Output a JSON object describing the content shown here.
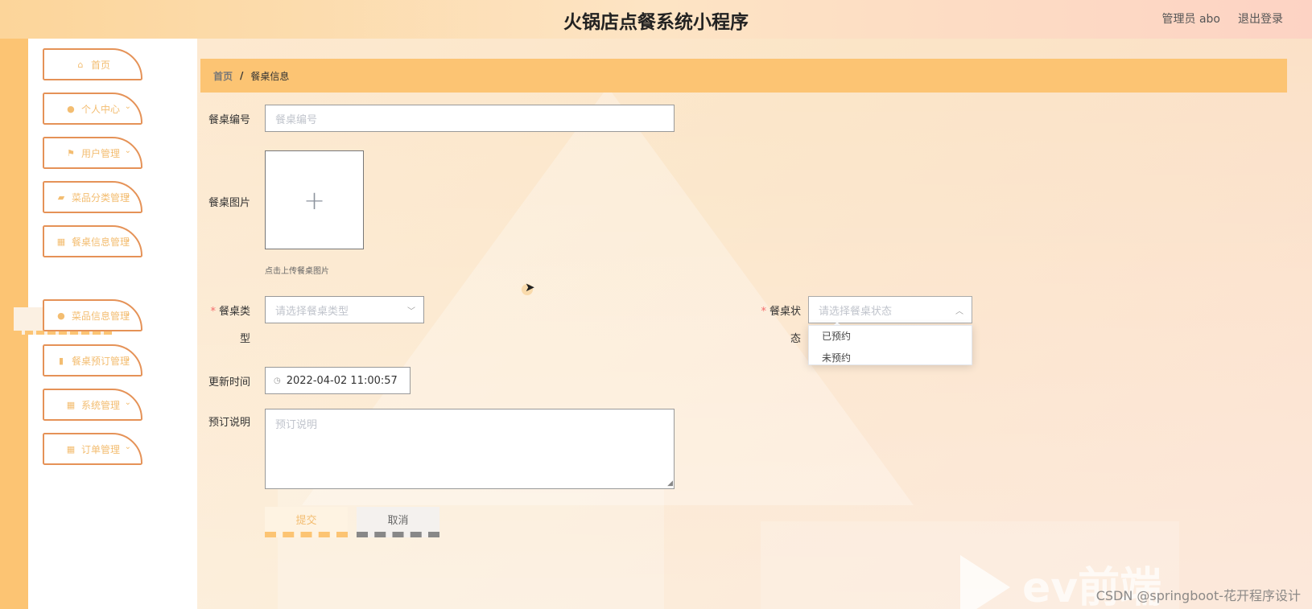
{
  "header": {
    "title": "火锅店点餐系统小程序",
    "user_label": "管理员 abo",
    "logout_label": "退出登录"
  },
  "sidebar": {
    "items": [
      {
        "label": "首页",
        "icon": "home-icon",
        "has_arrow": false
      },
      {
        "label": "个人中心",
        "icon": "user-icon",
        "has_arrow": true
      },
      {
        "label": "用户管理",
        "icon": "flag-icon",
        "has_arrow": true
      },
      {
        "label": "菜品分类管理",
        "icon": "chat-icon",
        "has_arrow": true
      },
      {
        "label": "餐桌信息管理",
        "icon": "grid-icon",
        "has_arrow": true
      },
      {
        "label": "菜品信息管理",
        "icon": "location-icon",
        "has_arrow": true
      },
      {
        "label": "餐桌预订管理",
        "icon": "bar-chart-icon",
        "has_arrow": true
      },
      {
        "label": "系统管理",
        "icon": "grid-icon",
        "has_arrow": true
      },
      {
        "label": "订单管理",
        "icon": "grid-icon",
        "has_arrow": true
      }
    ],
    "active_sub": "餐桌信息"
  },
  "breadcrumb": {
    "home": "首页",
    "separator": "/",
    "current": "餐桌信息"
  },
  "form": {
    "table_no_label": "餐桌编号",
    "table_no_placeholder": "餐桌编号",
    "image_label": "餐桌图片",
    "upload_tip": "点击上传餐桌图片",
    "type_label_1": "餐桌类",
    "type_label_2": "型",
    "type_placeholder": "请选择餐桌类型",
    "status_label_1": "餐桌状",
    "status_label_2": "态",
    "status_placeholder": "请选择餐桌状态",
    "status_options": [
      "已预约",
      "未预约"
    ],
    "update_time_label": "更新时间",
    "update_time_value": "2022-04-02 11:00:57",
    "remark_label": "预订说明",
    "remark_placeholder": "预订说明",
    "submit_label": "提交",
    "cancel_label": "取消",
    "required_mark": "*"
  },
  "watermark": "CSDN @springboot-花开程序设计",
  "logo_text": "ev前端",
  "colors": {
    "accent": "#fcc473",
    "menu_border": "#e59257",
    "menu_text": "#f3bd71"
  }
}
